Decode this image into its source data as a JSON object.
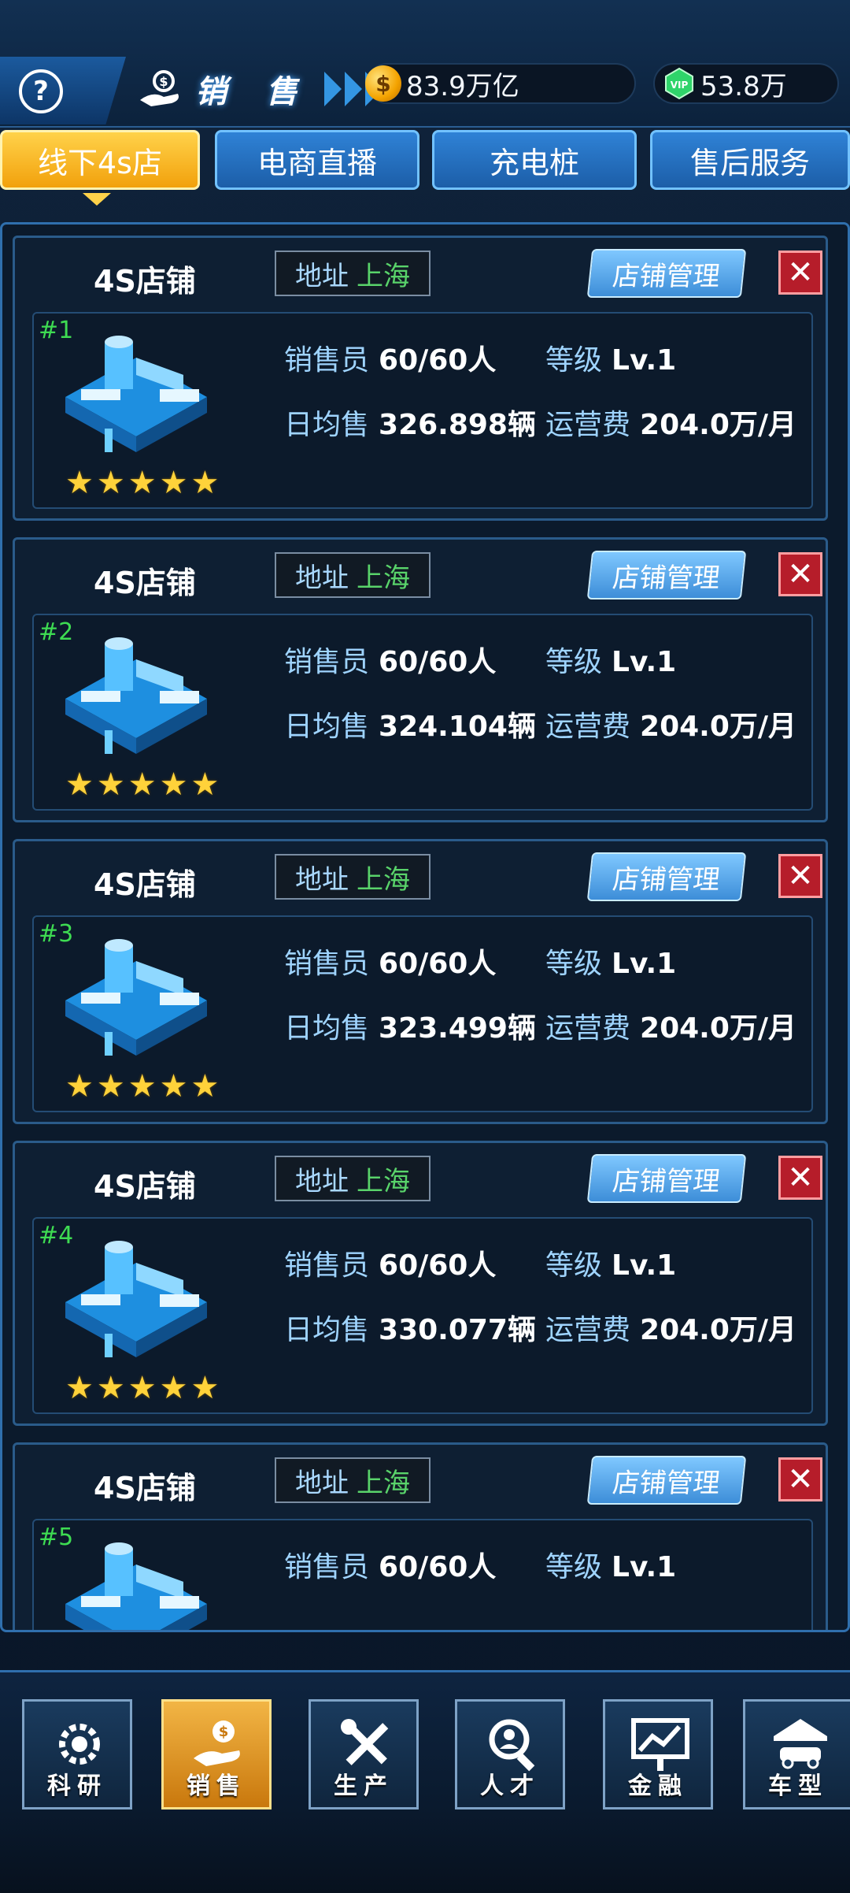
{
  "header": {
    "help_label": "?",
    "page_title": "销 售",
    "currencies": [
      {
        "icon": "gold-coin-icon",
        "value": "83.9万亿"
      },
      {
        "icon": "green-gem-icon",
        "value": "53.8万"
      }
    ]
  },
  "tabs": [
    {
      "label": "线下4s店",
      "active": true
    },
    {
      "label": "电商直播",
      "active": false
    },
    {
      "label": "充电桩",
      "active": false
    },
    {
      "label": "售后服务",
      "active": false
    }
  ],
  "stores": [
    {
      "name": "4S店铺",
      "addr_label": "地址",
      "city": "上海",
      "manage_label": "店铺管理",
      "close_label": "✕",
      "rank": "#1",
      "staff_label": "销售员",
      "staff": "60/60人",
      "level_label": "等级",
      "level": "Lv.1",
      "daily_label": "日均售",
      "daily": "326.898辆",
      "cost_label": "运营费",
      "cost": "204.0万/月",
      "stars": 5
    },
    {
      "name": "4S店铺",
      "addr_label": "地址",
      "city": "上海",
      "manage_label": "店铺管理",
      "close_label": "✕",
      "rank": "#2",
      "staff_label": "销售员",
      "staff": "60/60人",
      "level_label": "等级",
      "level": "Lv.1",
      "daily_label": "日均售",
      "daily": "324.104辆",
      "cost_label": "运营费",
      "cost": "204.0万/月",
      "stars": 5
    },
    {
      "name": "4S店铺",
      "addr_label": "地址",
      "city": "上海",
      "manage_label": "店铺管理",
      "close_label": "✕",
      "rank": "#3",
      "staff_label": "销售员",
      "staff": "60/60人",
      "level_label": "等级",
      "level": "Lv.1",
      "daily_label": "日均售",
      "daily": "323.499辆",
      "cost_label": "运营费",
      "cost": "204.0万/月",
      "stars": 5
    },
    {
      "name": "4S店铺",
      "addr_label": "地址",
      "city": "上海",
      "manage_label": "店铺管理",
      "close_label": "✕",
      "rank": "#4",
      "staff_label": "销售员",
      "staff": "60/60人",
      "level_label": "等级",
      "level": "Lv.1",
      "daily_label": "日均售",
      "daily": "330.077辆",
      "cost_label": "运营费",
      "cost": "204.0万/月",
      "stars": 5
    },
    {
      "name": "4S店铺",
      "addr_label": "地址",
      "city": "上海",
      "manage_label": "店铺管理",
      "close_label": "✕",
      "rank": "#5",
      "staff_label": "销售员",
      "staff": "60/60人",
      "level_label": "等级",
      "level": "Lv.1"
    }
  ],
  "bottom_nav": [
    {
      "label": "科研",
      "icon": "research-gear-icon",
      "active": false
    },
    {
      "label": "销售",
      "icon": "sales-money-hand-icon",
      "active": true
    },
    {
      "label": "生产",
      "icon": "production-tools-icon",
      "active": false
    },
    {
      "label": "人才",
      "icon": "talent-search-icon",
      "active": false
    },
    {
      "label": "金融",
      "icon": "finance-chart-icon",
      "active": false
    },
    {
      "label": "车型",
      "icon": "car-garage-icon",
      "active": false
    }
  ],
  "colors": {
    "accent_gold": "#f2a10c",
    "city_green": "#59d36a",
    "rank_green": "#3edc52",
    "close_red": "#b61d2a"
  }
}
